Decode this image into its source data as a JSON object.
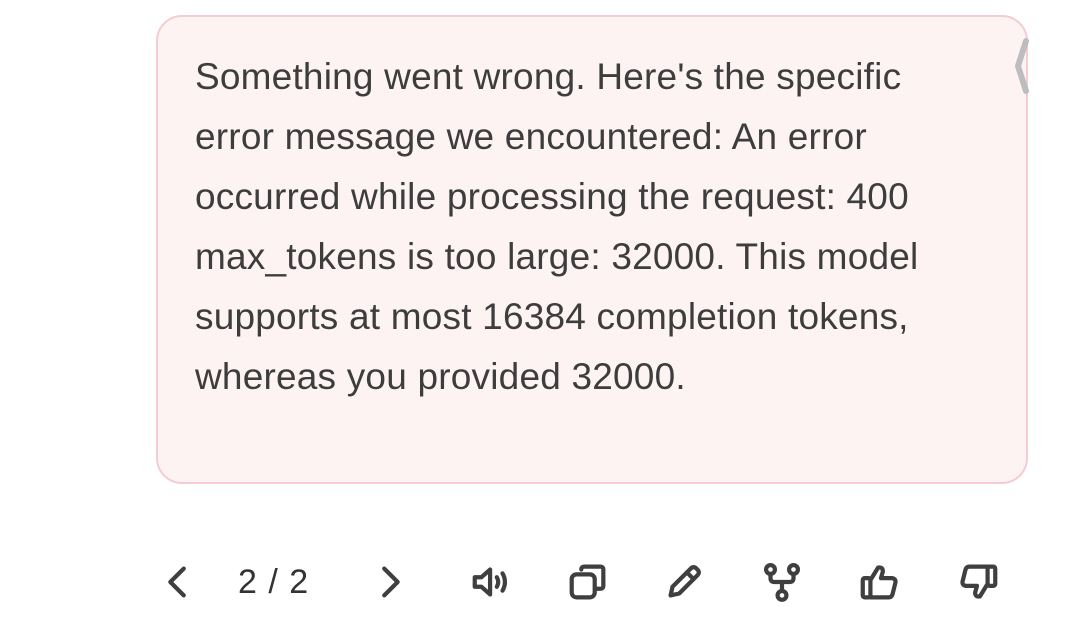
{
  "message": {
    "text": "Something went wrong. Here's the specific error message we encountered: An error occurred while processing the request: 400 max_tokens is too large: 32000. This model supports at most 16384 completion tokens, whereas you provided 32000."
  },
  "pagination": {
    "label": "2 / 2"
  },
  "toolbar": {
    "icons": [
      "chevron-left-icon",
      "chevron-right-icon",
      "speaker-icon",
      "copy-icon",
      "pencil-icon",
      "branch-icon",
      "thumbs-up-icon",
      "thumbs-down-icon"
    ]
  },
  "colors": {
    "bubble_background": "#fdf3f3",
    "bubble_border": "#f3cdd0",
    "icon": "#3f3f3f"
  }
}
